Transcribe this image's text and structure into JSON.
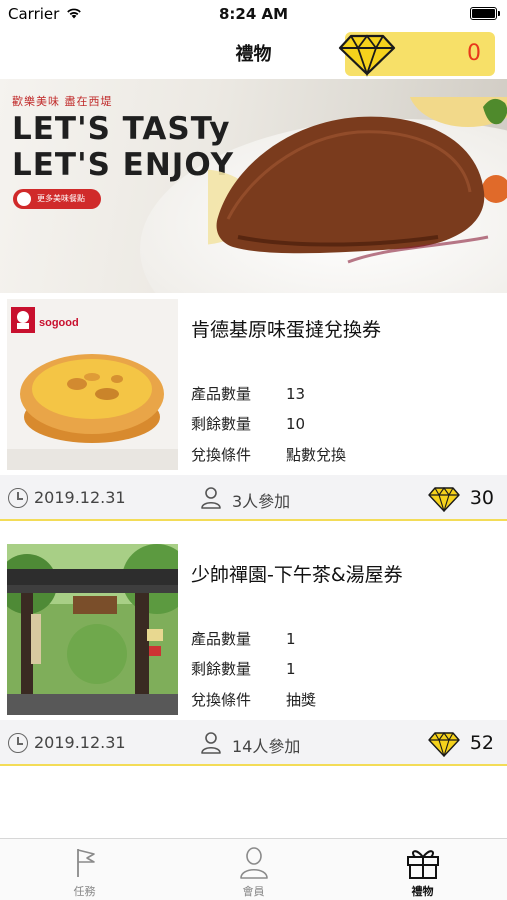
{
  "status_bar": {
    "carrier": "Carrier",
    "time": "8:24 AM"
  },
  "nav": {
    "title": "禮物",
    "points": "0",
    "points_color": "#e8381b",
    "pill_color": "#f7e068",
    "icon": "diamond-icon"
  },
  "banner": {
    "subtitle": "歡樂美味 盡在西堤",
    "headline_1": "LET'S TASTy",
    "headline_2": "LET'S ENJOY",
    "button_label": "更多美味餐點",
    "pages": 5,
    "active_page": 1
  },
  "cards": [
    {
      "brand": "sogood",
      "title": "肯德基原味蛋撻兌換券",
      "rows": [
        {
          "label": "產品數量",
          "value": "13"
        },
        {
          "label": "剩餘數量",
          "value": "10"
        },
        {
          "label": "兌換條件",
          "value": "點數兌換"
        }
      ],
      "date": "2019.12.31",
      "participants": "3人參加",
      "points": "30"
    },
    {
      "title": "少帥禪園-下午茶&湯屋券",
      "rows": [
        {
          "label": "產品數量",
          "value": "1"
        },
        {
          "label": "剩餘數量",
          "value": "1"
        },
        {
          "label": "兌換條件",
          "value": "抽獎"
        }
      ],
      "date": "2019.12.31",
      "participants": "14人參加",
      "points": "52"
    }
  ],
  "tabs": [
    {
      "label": "任務",
      "icon": "flag-icon",
      "active": false
    },
    {
      "label": "會員",
      "icon": "person-icon",
      "active": false
    },
    {
      "label": "禮物",
      "icon": "gift-icon",
      "active": true
    }
  ],
  "colors": {
    "accent_yellow": "#f3dc57",
    "gem_yellow": "#f5d21c",
    "footer_bg": "#f3f3f5"
  }
}
